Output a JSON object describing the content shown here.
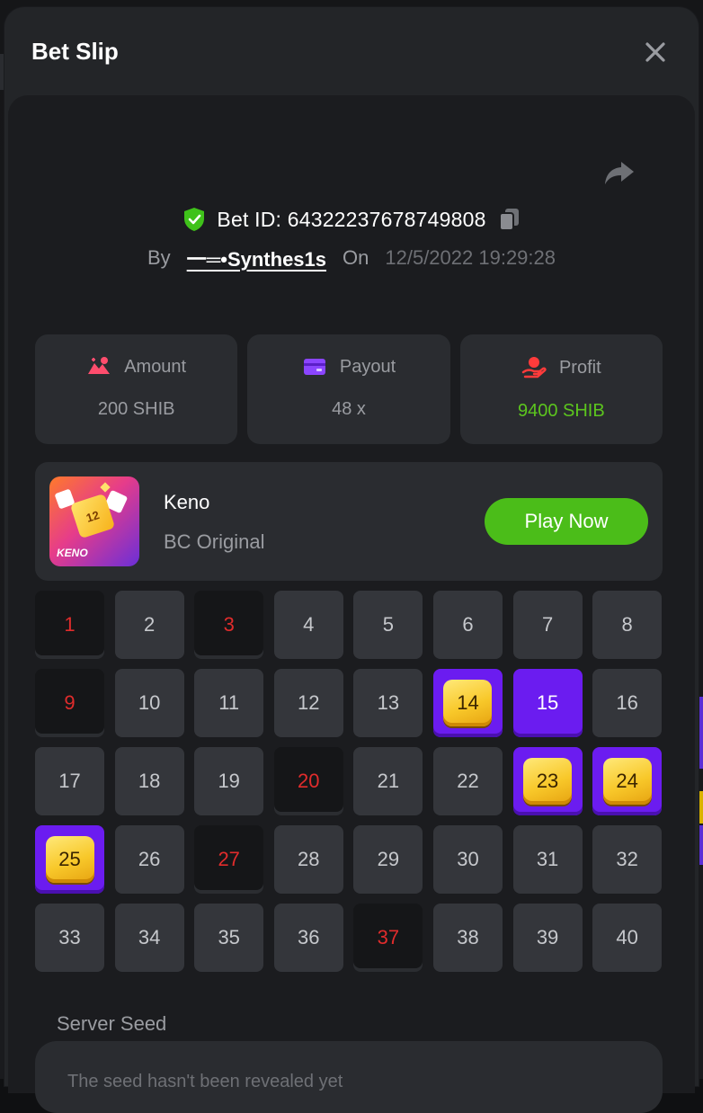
{
  "header": {
    "title": "Bet Slip"
  },
  "bet": {
    "id_label": "Bet ID: 64322237678749808",
    "by_label": "By",
    "username": "一═•Synthes1s",
    "on_label": "On",
    "datetime": "12/5/2022 19:29:28"
  },
  "stats": [
    {
      "label": "Amount",
      "value": "200 SHIB",
      "icon": "amount-icon",
      "icon_color": "#ff4d6d"
    },
    {
      "label": "Payout",
      "value": "48 x",
      "icon": "card-icon",
      "icon_color": "#8b45ff"
    },
    {
      "label": "Profit",
      "value": "9400 SHIB",
      "icon": "hand-coin-icon",
      "icon_color": "#ff3b3b",
      "value_color": "#5cc51e"
    }
  ],
  "game": {
    "name": "Keno",
    "provider": "BC Original",
    "play_label": "Play Now",
    "thumb_label": "KENO",
    "thumb_tile": "12"
  },
  "keno": {
    "numbers": [
      "1",
      "2",
      "3",
      "4",
      "5",
      "6",
      "7",
      "8",
      "9",
      "10",
      "11",
      "12",
      "13",
      "14",
      "15",
      "16",
      "17",
      "18",
      "19",
      "20",
      "21",
      "22",
      "23",
      "24",
      "25",
      "26",
      "27",
      "28",
      "29",
      "30",
      "31",
      "32",
      "33",
      "34",
      "35",
      "36",
      "37",
      "38",
      "39",
      "40"
    ],
    "states": [
      "drawn",
      "normal",
      "drawn",
      "normal",
      "normal",
      "normal",
      "normal",
      "normal",
      "drawn",
      "normal",
      "normal",
      "normal",
      "normal",
      "hit",
      "picked",
      "normal",
      "normal",
      "normal",
      "normal",
      "drawn",
      "normal",
      "normal",
      "hit",
      "hit",
      "hit",
      "normal",
      "drawn",
      "normal",
      "normal",
      "normal",
      "normal",
      "normal",
      "normal",
      "normal",
      "normal",
      "normal",
      "drawn",
      "normal",
      "normal",
      "normal"
    ]
  },
  "seed": {
    "label": "Server Seed",
    "text": "The seed hasn't been revealed yet"
  },
  "colors": {
    "accent_purple": "#6b1cf0",
    "play_green": "#4bbd19",
    "drawn_red": "#e02c2c",
    "verified_green": "#3fc21a"
  }
}
